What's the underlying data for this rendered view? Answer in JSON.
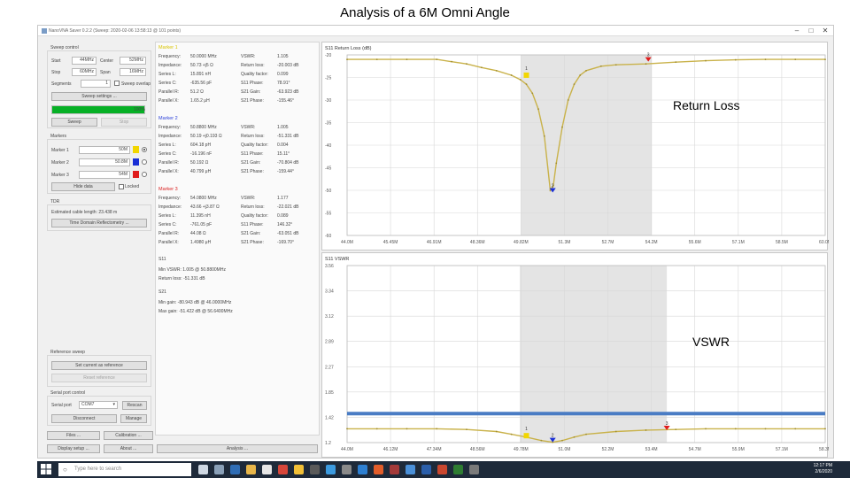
{
  "slide": {
    "title": "Analysis of a 6M Omni Angle"
  },
  "window": {
    "title": "NanoVNA Saver 0.2.2 (Sweep: 2020-02-06 13:58:13 @ 101 points)",
    "minimize": "–",
    "maximize": "□",
    "close": "✕"
  },
  "sweep": {
    "title": "Sweep control",
    "start_label": "Start",
    "start": "44MHz",
    "center_label": "Center",
    "center": "52MHz",
    "stop_label": "Stop",
    "stop": "60MHz",
    "span_label": "Span",
    "span": "16MHz",
    "segments_label": "Segments",
    "segments": "1",
    "overlap_label": "Sweep overlap",
    "settings_btn": "Sweep settings ...",
    "progress": 100,
    "progress_text": "100%",
    "sweep_btn": "Sweep",
    "stop_btn": "Stop"
  },
  "markers_panel": {
    "title": "Markers",
    "rows": [
      {
        "label": "Marker 1",
        "value": "50M",
        "color": "#f2d600",
        "selected": true
      },
      {
        "label": "Marker 2",
        "value": "50.8M",
        "color": "#1a2fd6",
        "selected": false
      },
      {
        "label": "Marker 3",
        "value": "54M",
        "color": "#e01c1c",
        "selected": false
      }
    ],
    "hide_btn": "Hide data",
    "locked_label": "Locked"
  },
  "tdr": {
    "title": "TDR",
    "cable_label": "Estimated cable length: 23.438 m",
    "btn": "Time Domain Reflectometry ..."
  },
  "reference": {
    "title": "Reference sweep",
    "set_btn": "Set current as reference",
    "reset_btn": "Reset reference"
  },
  "serial": {
    "title": "Serial port control",
    "port_label": "Serial port",
    "port": "COM7",
    "rescan_btn": "Rescan",
    "disconnect_btn": "Disconnect",
    "manage_btn": "Manage"
  },
  "bottom_buttons": {
    "files": "Files ...",
    "calibration": "Calibration ...",
    "display": "Display setup ...",
    "about": "About ...",
    "analysis": "Analysis ..."
  },
  "marker_data": [
    {
      "title": "Marker 1",
      "color": "#d8c300",
      "left": [
        [
          "Frequency:",
          "50.0000 MHz"
        ],
        [
          "Impedance:",
          "50.73 +j5 Ω"
        ],
        [
          "Series L:",
          "15.891 nH"
        ],
        [
          "Series C:",
          "-635.56 pF"
        ],
        [
          "Parallel R:",
          "51.2 Ω"
        ],
        [
          "Parallel X:",
          "1.65.2 μH"
        ]
      ],
      "right": [
        [
          "VSWR:",
          "1.105"
        ],
        [
          "Return loss:",
          "-20.003 dB"
        ],
        [
          "Quality factor:",
          "0.099"
        ],
        [
          "S11 Phase:",
          "78.91°"
        ],
        [
          "S21 Gain:",
          "-63.923 dB"
        ],
        [
          "S21 Phase:",
          "-155.46°"
        ]
      ]
    },
    {
      "title": "Marker 2",
      "color": "#2a3fd8",
      "left": [
        [
          "Frequency:",
          "50.8800 MHz"
        ],
        [
          "Impedance:",
          "50.19 +j0.193 Ω"
        ],
        [
          "Series L:",
          "604.18 pH"
        ],
        [
          "Series C:",
          "-16.196 nF"
        ],
        [
          "Parallel R:",
          "50.192 Ω"
        ],
        [
          "Parallel X:",
          "40.799 μH"
        ]
      ],
      "right": [
        [
          "VSWR:",
          "1.005"
        ],
        [
          "Return loss:",
          "-51.331 dB"
        ],
        [
          "Quality factor:",
          "0.004"
        ],
        [
          "S11 Phase:",
          "15.11°"
        ],
        [
          "S21 Gain:",
          "-70.804 dB"
        ],
        [
          "S21 Phase:",
          "-159.44°"
        ]
      ]
    },
    {
      "title": "Marker 3",
      "color": "#d92020",
      "left": [
        [
          "Frequency:",
          "54.0800 MHz"
        ],
        [
          "Impedance:",
          "43.66 +j3.87 Ω"
        ],
        [
          "Series L:",
          "11.395 nH"
        ],
        [
          "Series C:",
          "-761.05 pF"
        ],
        [
          "Parallel R:",
          "44.08 Ω"
        ],
        [
          "Parallel X:",
          "1.4980 μH"
        ]
      ],
      "right": [
        [
          "VSWR:",
          "1.177"
        ],
        [
          "Return loss:",
          "-22.021 dB"
        ],
        [
          "Quality factor:",
          "0.089"
        ],
        [
          "S11 Phase:",
          "146.32°"
        ],
        [
          "S21 Gain:",
          "-63.051 dB"
        ],
        [
          "S21 Phase:",
          "-169.70°"
        ]
      ]
    }
  ],
  "summary": {
    "s11_title": "S11",
    "min_vswr": "Min VSWR: 1.005 @ 50.8800MHz",
    "rl": "Return loss: -51.331 dB",
    "s21_title": "S21",
    "min_gain": "Min gain: -80.943 dB @ 46.0000MHz",
    "max_gain": "Max gain: -51.422 dB @ 56.6400MHz"
  },
  "overlay": {
    "return_loss": "Return Loss",
    "vswr": "VSWR"
  },
  "taskbar": {
    "search_placeholder": "Type here to search",
    "time": "12:17 PM",
    "date": "2/6/2020"
  },
  "chart_data": [
    {
      "type": "line",
      "title": "S11 Return Loss (dB)",
      "xlabel": "",
      "ylabel": "",
      "xlim": [
        44,
        60
      ],
      "ylim": [
        -60,
        -20
      ],
      "x_ticks": [
        "44.0M",
        "45.45M",
        "46.91M",
        "48.36M",
        "49.82M",
        "51.3M",
        "52.7M",
        "54.2M",
        "55.6M",
        "57.1M",
        "58.5M",
        "60.0M"
      ],
      "y_ticks": [
        "-20",
        "-25",
        "-30",
        "-35",
        "-40",
        "-45",
        "-50",
        "-55",
        "-60"
      ],
      "grid": true,
      "highlight_x": [
        49.82,
        54.2
      ],
      "series": [
        {
          "x": [
            44,
            45,
            46,
            47,
            47.5,
            48,
            48.5,
            49,
            49.5,
            49.8,
            50,
            50.2,
            50.4,
            50.6,
            50.8,
            50.9,
            51.0,
            51.2,
            51.4,
            51.6,
            51.8,
            52,
            52.5,
            53,
            54,
            55,
            56,
            57,
            58,
            59,
            60
          ],
          "y": [
            -21,
            -21,
            -21,
            -21,
            -21.5,
            -22,
            -22.8,
            -23.5,
            -24.5,
            -25.5,
            -26.5,
            -28.5,
            -32,
            -38,
            -50,
            -49,
            -44,
            -36,
            -30,
            -26.5,
            -24.5,
            -23.5,
            -22.5,
            -22.2,
            -22,
            -21.6,
            -21.3,
            -21.1,
            -21,
            -21,
            -21
          ]
        }
      ],
      "markers": [
        {
          "label": "1",
          "x": 50.0,
          "y": -24.5,
          "color": "#f2d600",
          "shape": "square"
        },
        {
          "label": "2",
          "x": 50.88,
          "y": -50.5,
          "color": "#1a2fd6",
          "shape": "triangle"
        },
        {
          "label": "3",
          "x": 54.08,
          "y": -21.5,
          "color": "#e01c1c",
          "shape": "triangle"
        }
      ]
    },
    {
      "type": "line",
      "title": "S11 VSWR",
      "xlabel": "",
      "ylabel": "",
      "xlim": [
        44,
        60
      ],
      "ylim": [
        1.0,
        3.56
      ],
      "x_ticks": [
        "44.0M",
        "46.12M",
        "47.34M",
        "48.56M",
        "49.78M",
        "51.0M",
        "52.2M",
        "53.4M",
        "54.7M",
        "55.9M",
        "57.1M",
        "58.3M"
      ],
      "y_ticks": [
        "3.56",
        "3.34",
        "3.12",
        "2.89",
        "2.27",
        "1.85",
        "1.42",
        "1.2"
      ],
      "grid": true,
      "highlight_x": [
        49.78,
        54.7
      ],
      "reference_y": 1.42,
      "series": [
        {
          "x": [
            44,
            45,
            46,
            47,
            48,
            49,
            49.5,
            50,
            50.5,
            50.88,
            51.2,
            51.6,
            52,
            53,
            54,
            55,
            56,
            57,
            58,
            59,
            60
          ],
          "y": [
            1.2,
            1.2,
            1.2,
            1.2,
            1.19,
            1.16,
            1.12,
            1.08,
            1.03,
            1.005,
            1.03,
            1.08,
            1.12,
            1.16,
            1.18,
            1.19,
            1.2,
            1.2,
            1.2,
            1.2,
            1.2
          ]
        }
      ],
      "markers": [
        {
          "label": "1",
          "x": 50.0,
          "y": 1.1,
          "color": "#f2d600",
          "shape": "square"
        },
        {
          "label": "2",
          "x": 50.88,
          "y": 1.005,
          "color": "#1a2fd6",
          "shape": "triangle"
        },
        {
          "label": "3",
          "x": 54.7,
          "y": 1.18,
          "color": "#e01c1c",
          "shape": "triangle"
        }
      ]
    }
  ]
}
